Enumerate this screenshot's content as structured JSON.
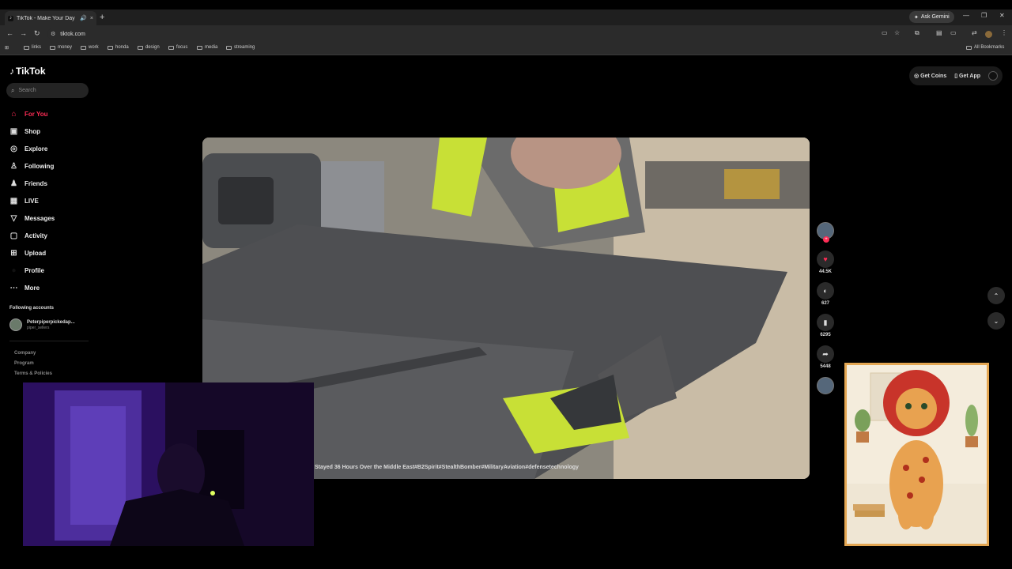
{
  "browser": {
    "tab_title": "TikTok - Make Your Day",
    "tab_close": "×",
    "tab_audio": "🔊",
    "new_tab": "+",
    "ask_gemini": "Ask Gemini",
    "minimize": "—",
    "restore": "❐",
    "close": "✕",
    "url": "tiktok.com",
    "bookmarks": [
      "links",
      "money",
      "work",
      "honda",
      "design",
      "focus",
      "media",
      "streaming"
    ],
    "all_bookmarks": "All Bookmarks"
  },
  "tiktok": {
    "logo": "TikTok",
    "search_placeholder": "Search",
    "nav": [
      {
        "label": "For You",
        "icon": "home-icon",
        "glyph": "⌂"
      },
      {
        "label": "Shop",
        "icon": "bag-icon",
        "glyph": "▣"
      },
      {
        "label": "Explore",
        "icon": "compass-icon",
        "glyph": "◎"
      },
      {
        "label": "Following",
        "icon": "user-plus-icon",
        "glyph": "♙"
      },
      {
        "label": "Friends",
        "icon": "people-icon",
        "glyph": "♟"
      },
      {
        "label": "LIVE",
        "icon": "live-icon",
        "glyph": "▦"
      },
      {
        "label": "Messages",
        "icon": "send-icon",
        "glyph": "▽"
      },
      {
        "label": "Activity",
        "icon": "message-icon",
        "glyph": "▢"
      },
      {
        "label": "Upload",
        "icon": "upload-icon",
        "glyph": "⊞"
      },
      {
        "label": "Profile",
        "icon": "profile-icon",
        "glyph": "●"
      },
      {
        "label": "More",
        "icon": "more-icon",
        "glyph": "⋯"
      }
    ],
    "following_accounts_heading": "Following accounts",
    "following_account_name": "Peterpiperpickedap...",
    "following_account_handle": "piper_sellers",
    "footer": [
      "Company",
      "Program",
      "Terms & Policies"
    ],
    "get_coins": "Get Coins",
    "get_app": "Get App",
    "caption": "Stayed 36 Hours Over the Middle East#B2Spirit#StealthBomber#MilitaryAviation#defensetechnology",
    "likes": "44.5K",
    "comments": "627",
    "saves": "6295",
    "shares": "5448",
    "accent": "#fe2c55"
  }
}
